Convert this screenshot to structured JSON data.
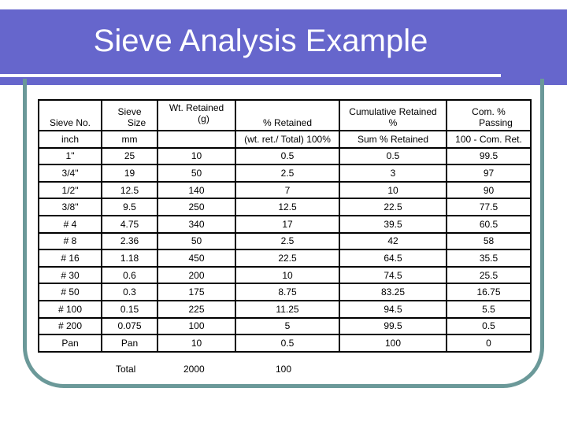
{
  "slide": {
    "title": "Sieve Analysis Example",
    "colors": {
      "banner": "#6666cc",
      "frame": "#6b9999",
      "title_text": "#ffffff"
    }
  },
  "table": {
    "headers": [
      {
        "line1": "",
        "line2": "Sieve No."
      },
      {
        "line1": "Sieve",
        "line2": "Size"
      },
      {
        "line1": "Wt. Retained",
        "line2": "(g)"
      },
      {
        "line1": "",
        "line2": "% Retained"
      },
      {
        "line1": "Cumulative Retained",
        "line2": "%"
      },
      {
        "line1": "Com. %",
        "line2": "Passing"
      }
    ],
    "units": [
      "inch",
      "mm",
      "",
      "(wt. ret./ Total) 100%",
      "Sum % Retained",
      "100 - Com. Ret."
    ],
    "rows": [
      [
        "1\"",
        "25",
        "10",
        "0.5",
        "0.5",
        "99.5"
      ],
      [
        "3/4\"",
        "19",
        "50",
        "2.5",
        "3",
        "97"
      ],
      [
        "1/2\"",
        "12.5",
        "140",
        "7",
        "10",
        "90"
      ],
      [
        "3/8\"",
        "9.5",
        "250",
        "12.5",
        "22.5",
        "77.5"
      ],
      [
        "# 4",
        "4.75",
        "340",
        "17",
        "39.5",
        "60.5"
      ],
      [
        "# 8",
        "2.36",
        "50",
        "2.5",
        "42",
        "58"
      ],
      [
        "# 16",
        "1.18",
        "450",
        "22.5",
        "64.5",
        "35.5"
      ],
      [
        "# 30",
        "0.6",
        "200",
        "10",
        "74.5",
        "25.5"
      ],
      [
        "# 50",
        "0.3",
        "175",
        "8.75",
        "83.25",
        "16.75"
      ],
      [
        "# 100",
        "0.15",
        "225",
        "11.25",
        "94.5",
        "5.5"
      ],
      [
        "# 200",
        "0.075",
        "100",
        "5",
        "99.5",
        "0.5"
      ],
      [
        "Pan",
        "Pan",
        "10",
        "0.5",
        "100",
        "0"
      ]
    ]
  },
  "totals": {
    "label": "Total",
    "weight": "2000",
    "percent": "100"
  }
}
